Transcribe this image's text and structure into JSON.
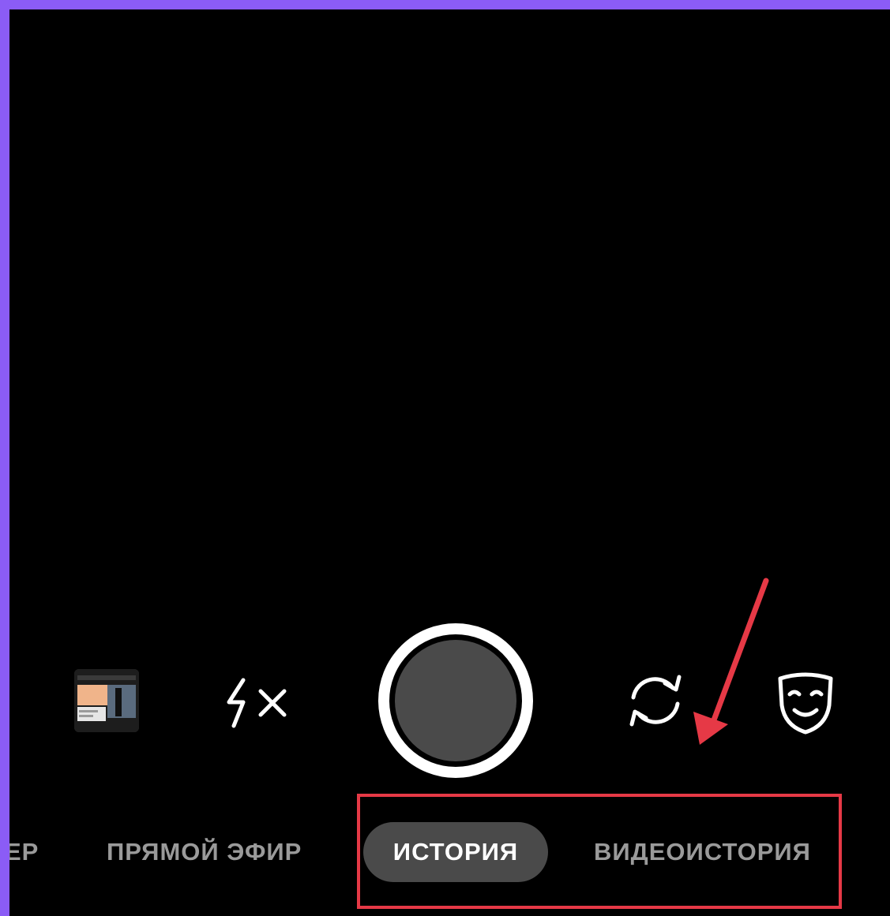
{
  "camera": {
    "modes": [
      {
        "label": "ЕР",
        "state": "partial"
      },
      {
        "label": "ПРЯМОЙ ЭФИР",
        "state": "inactive"
      },
      {
        "label": "ИСТОРИЯ",
        "state": "active"
      },
      {
        "label": "ВИДЕОИСТОРИЯ",
        "state": "inactive"
      }
    ],
    "icons": {
      "gallery": "gallery-thumbnail",
      "flash": "flash-off-icon",
      "shutter": "shutter-button",
      "flip": "flip-camera-icon",
      "mask": "mask-effects-icon"
    }
  },
  "annotation": {
    "arrow_color": "#e63946",
    "box_color": "#e63946"
  },
  "colors": {
    "frame_background": "#8b5cf6",
    "viewport": "#000000",
    "active_pill": "#4a4a4a",
    "inactive_text": "#9a9a9a",
    "active_text": "#ffffff"
  }
}
